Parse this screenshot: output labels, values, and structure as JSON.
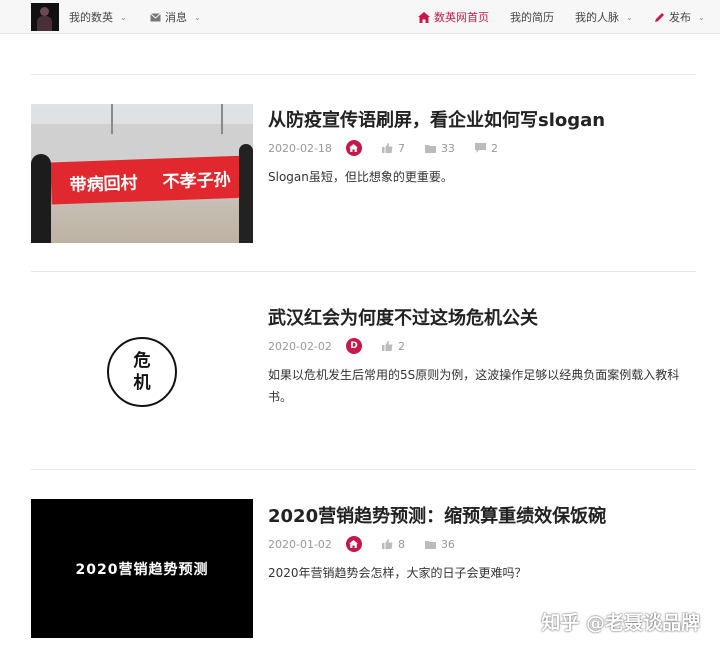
{
  "nav": {
    "my_shuying": "我的数英",
    "messages": "消息",
    "home": "数英网首页",
    "resume": "我的简历",
    "network": "我的人脉",
    "publish": "发布"
  },
  "articles": [
    {
      "title": "从防疫宣传语刷屏，看企业如何写slogan",
      "date": "2020-02-18",
      "badge": "",
      "badge_color": "#c8174b",
      "likes": "7",
      "favorites": "33",
      "comments": "2",
      "summary": "Slogan虽短，但比想象的更重要。",
      "thumb_text": [
        "带病回村",
        "不孝子孙"
      ]
    },
    {
      "title": "武汉红会为何度不过这场危机公关",
      "date": "2020-02-02",
      "badge": "D",
      "badge_color": "#c8174b",
      "likes": "2",
      "summary": "如果以危机发生后常用的5S原则为例，这波操作足够以经典负面案例载入教科书。",
      "thumb_text": [
        "危",
        "机"
      ]
    },
    {
      "title": "2020营销趋势预测：缩预算重绩效保饭碗",
      "date": "2020-01-02",
      "badge": "",
      "badge_color": "#c8174b",
      "likes": "8",
      "favorites": "36",
      "summary": "2020年营销趋势会怎样，大家的日子会更难吗？",
      "thumb_text": "2020营销趋势预测"
    }
  ],
  "watermark": "知乎 @老聂谈品牌"
}
